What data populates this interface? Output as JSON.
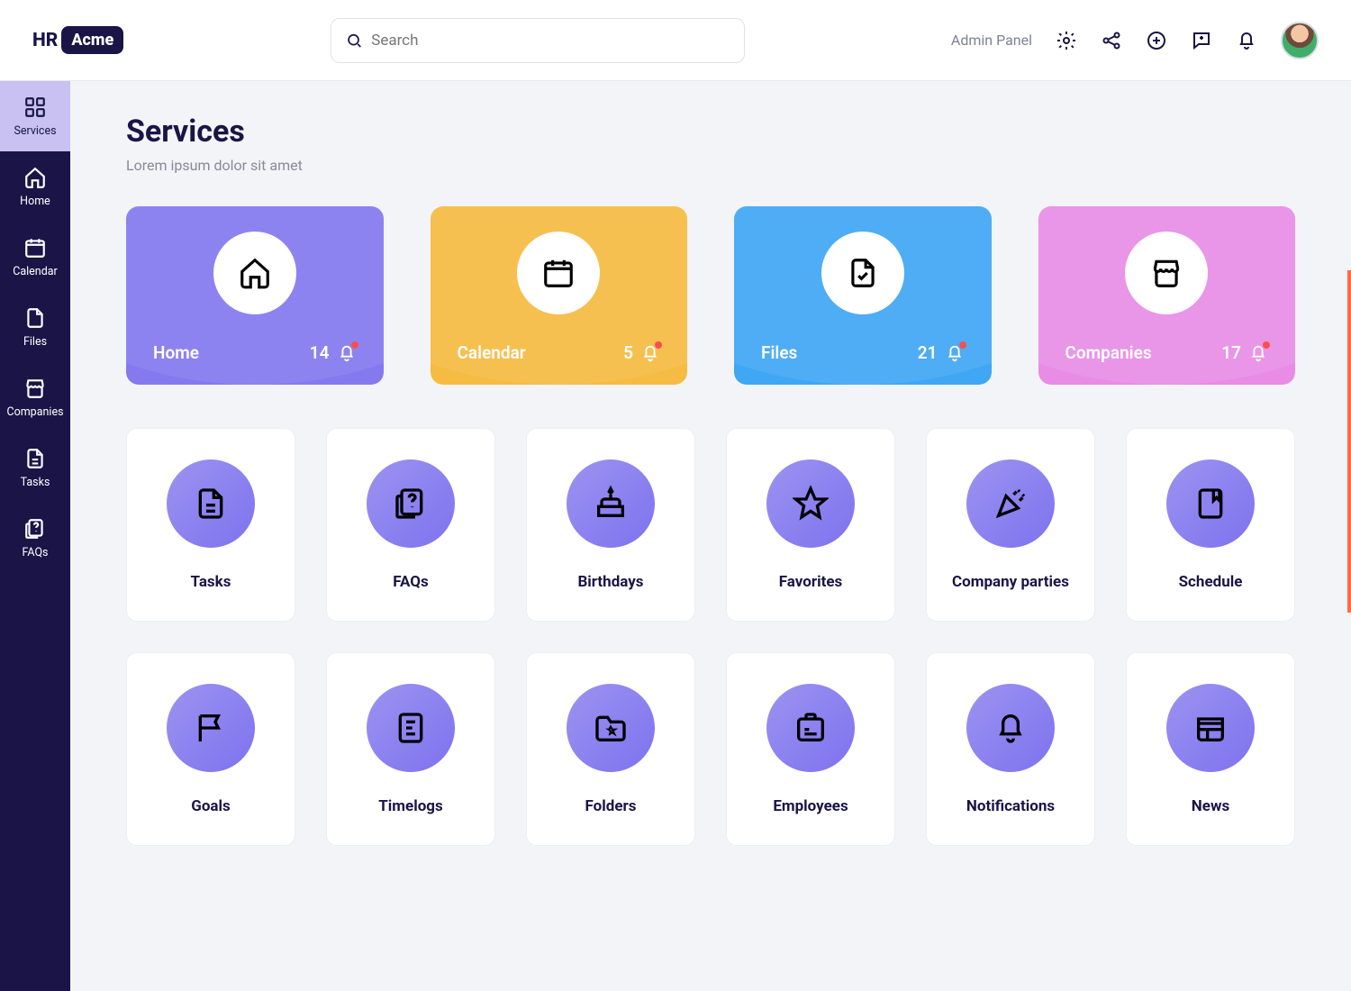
{
  "header": {
    "logo_left": "HR",
    "logo_right": "Acme",
    "search_placeholder": "Search",
    "admin_link": "Admin Panel"
  },
  "sidebar": {
    "items": [
      {
        "label": "Services",
        "icon": "grid"
      },
      {
        "label": "Home",
        "icon": "home"
      },
      {
        "label": "Calendar",
        "icon": "calendar"
      },
      {
        "label": "Files",
        "icon": "file"
      },
      {
        "label": "Companies",
        "icon": "store"
      },
      {
        "label": "Tasks",
        "icon": "task"
      },
      {
        "label": "FAQs",
        "icon": "faq"
      }
    ],
    "active_index": 0
  },
  "page": {
    "title": "Services",
    "subtitle": "Lorem ipsum dolor sit amet"
  },
  "big_cards": [
    {
      "label": "Home",
      "count": 14,
      "bg": "#8479ef",
      "icon": "home",
      "icon_color": "#8479ef"
    },
    {
      "label": "Calendar",
      "count": 5,
      "bg": "#f6bb42",
      "icon": "calendar",
      "icon_color": "#f6bb42"
    },
    {
      "label": "Files",
      "count": 21,
      "bg": "#3fa7f3",
      "icon": "filecheck",
      "icon_color": "#3fa7f3"
    },
    {
      "label": "Companies",
      "count": 17,
      "bg": "#e88ce6",
      "icon": "store",
      "icon_color": "#e88ce6"
    }
  ],
  "small_cards": [
    {
      "label": "Tasks",
      "icon": "task"
    },
    {
      "label": "FAQs",
      "icon": "faq"
    },
    {
      "label": "Birthdays",
      "icon": "cake"
    },
    {
      "label": "Favorites",
      "icon": "star"
    },
    {
      "label": "Company parties",
      "icon": "party"
    },
    {
      "label": "Schedule",
      "icon": "bookmark"
    },
    {
      "label": "Goals",
      "icon": "flag"
    },
    {
      "label": "Timelogs",
      "icon": "timelog"
    },
    {
      "label": "Folders",
      "icon": "folder"
    },
    {
      "label": "Employees",
      "icon": "badge"
    },
    {
      "label": "Notifications",
      "icon": "bell"
    },
    {
      "label": "News",
      "icon": "news"
    }
  ]
}
